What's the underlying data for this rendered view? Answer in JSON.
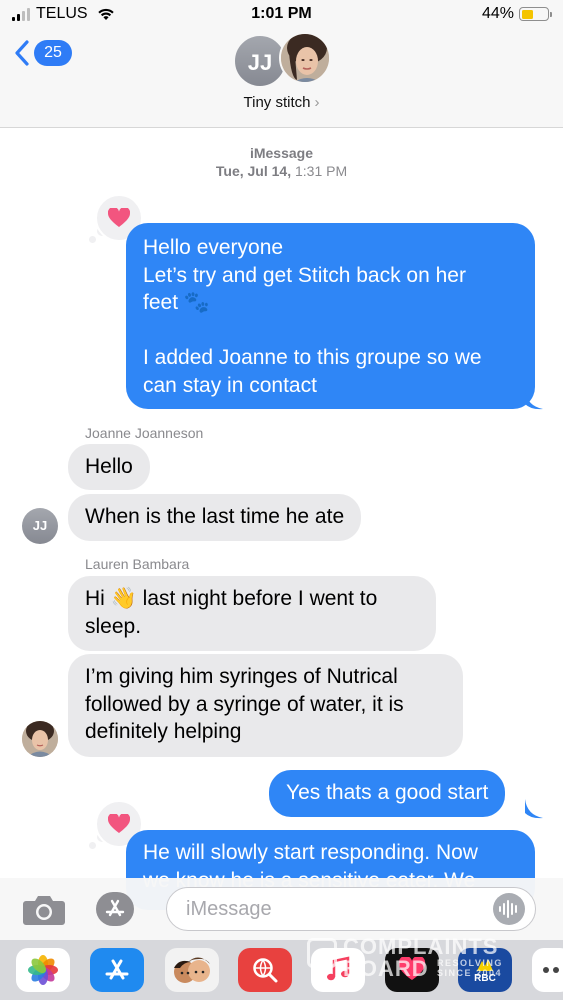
{
  "status_bar": {
    "carrier": "TELUS",
    "time": "1:01 PM",
    "battery": "44%",
    "battery_level": 0.44
  },
  "header": {
    "back_count": "25",
    "group_avatar_initials": "JJ",
    "group_name": "Tiny stitch",
    "chevron": "›"
  },
  "thread": {
    "service": "iMessage",
    "date": "Tue, Jul 14,",
    "time": "1:31 PM",
    "messages": [
      {
        "direction": "outgoing",
        "lines": [
          "Hello everyone",
          "Let’s try and get Stitch back on her",
          "feet 🐾",
          "",
          "I added Joanne to this groupe so we",
          "can stay in  contact"
        ],
        "tapback": "heart"
      },
      {
        "direction": "incoming",
        "sender": "Joanne  Joanneson",
        "text": "Hello"
      },
      {
        "direction": "incoming",
        "avatar": "JJ",
        "text": "When is the last time he ate"
      },
      {
        "direction": "incoming",
        "sender": "Lauren Bambara",
        "lines": [
          "Hi 👋 last night before I went to",
          "sleep."
        ]
      },
      {
        "direction": "incoming",
        "lines": [
          "I’m giving him syringes of Nutrical",
          "followed by a syringe of water, it is",
          "definitely helping"
        ]
      },
      {
        "direction": "outgoing",
        "text": "Yes thats a good start"
      },
      {
        "direction": "outgoing",
        "lines": [
          "He will slowly start responding. Now",
          "we know he is a sensitive eater. We"
        ],
        "tapback": "heart"
      }
    ]
  },
  "compose": {
    "placeholder": "iMessage"
  },
  "app_drawer": {
    "apps": [
      "photos-icon",
      "app-store-icon",
      "memoji-icon",
      "search-web-icon",
      "music-icon",
      "video-icon",
      "rbc-icon",
      "more-icon"
    ],
    "rbc_label": "RBC"
  },
  "watermark": {
    "line1": "COMPLAINTS",
    "line2": "BOARD",
    "side": "RESOLVING SINCE 2004"
  },
  "colors": {
    "outgoing_bubble": "#2f86f6",
    "incoming_bubble": "#e9e9eb",
    "heart": "#f2557f",
    "accent": "#2f7cf6"
  }
}
